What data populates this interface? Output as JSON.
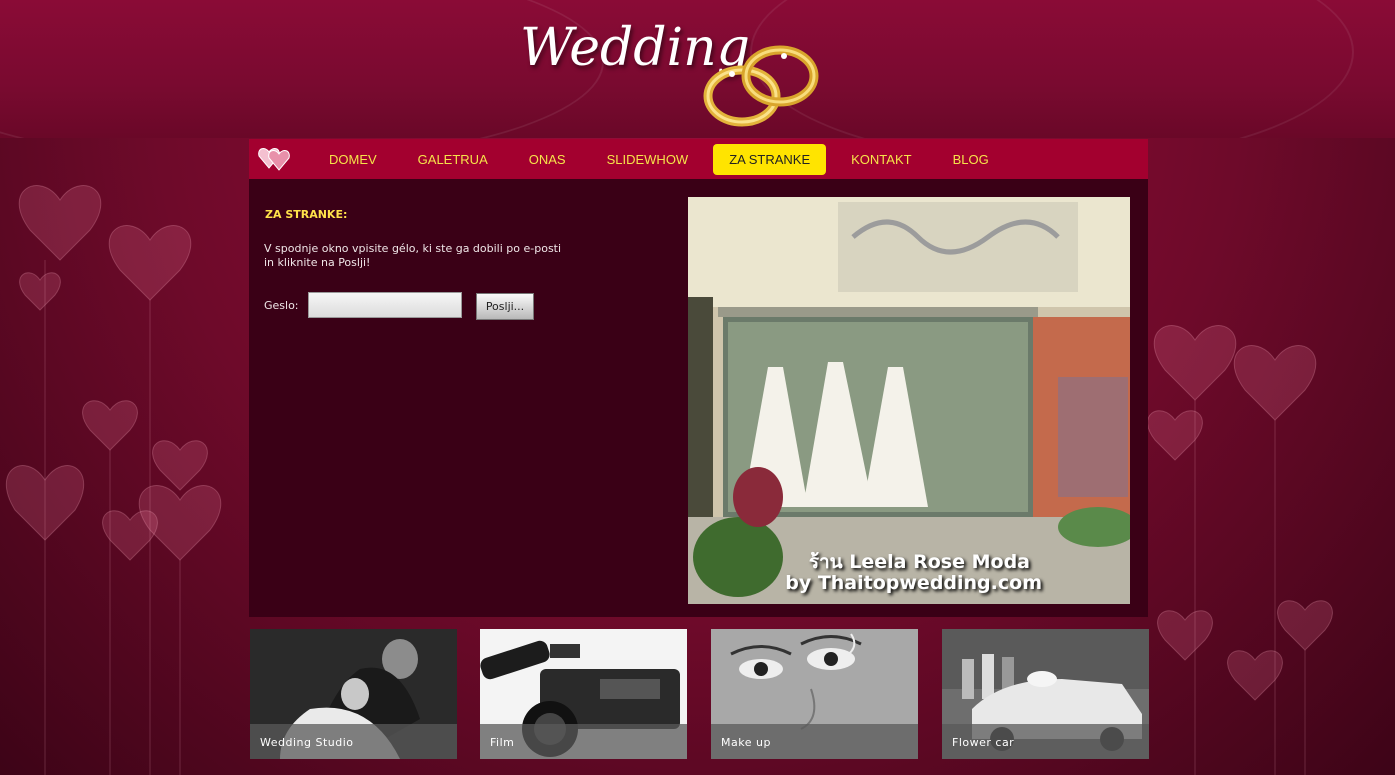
{
  "header": {
    "logo_text": "Wedding"
  },
  "nav": {
    "items": [
      {
        "label": "DOMEV",
        "active": false
      },
      {
        "label": "GALETRUA",
        "active": false
      },
      {
        "label": "ONAS",
        "active": false
      },
      {
        "label": "SLIDEWHOW",
        "active": false
      },
      {
        "label": "ZA STRANKE",
        "active": true
      },
      {
        "label": "KONTAKT",
        "active": false
      },
      {
        "label": "BLOG",
        "active": false
      }
    ]
  },
  "main": {
    "section_title": "ZA STRANKE:",
    "instructions": "V spodnje okno vpisite gélo, ki ste ga dobili po e-posti in kliknite na Poslji!",
    "password_label": "Geslo:",
    "password_value": "",
    "submit_label": "Poslji...",
    "photo_caption_line1": "ร้าน Leela Rose Moda",
    "photo_caption_line2": "by Thaitopwedding.com"
  },
  "thumbnails": [
    {
      "label": "Wedding Studio"
    },
    {
      "label": "Film"
    },
    {
      "label": "Make up"
    },
    {
      "label": "Flower car"
    }
  ],
  "colors": {
    "nav_bg": "#a3002f",
    "nav_text": "#f6e34a",
    "active_tab": "#ffe400",
    "content_bg": "#3a0016",
    "title_text": "#ffe24a"
  }
}
